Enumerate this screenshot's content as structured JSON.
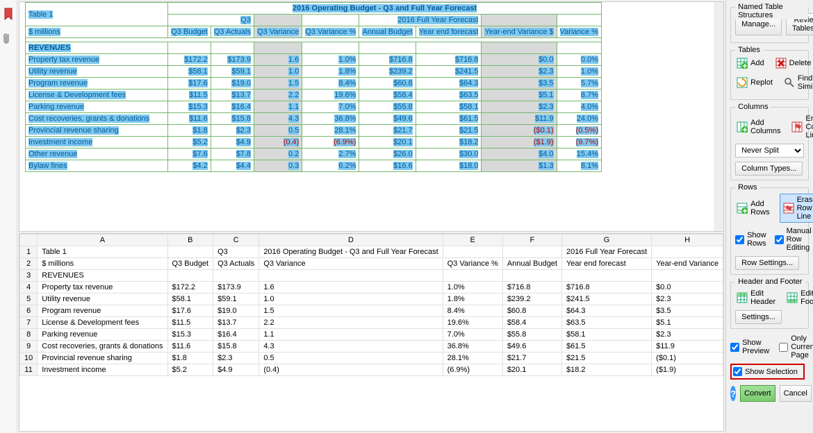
{
  "preview": {
    "title": "2016 Operating Budget - Q3 and Full Year Forecast",
    "table_label": "Table 1",
    "q3_label": "Q3",
    "fy_label": "2016 Full Year Forecast",
    "unit": "$ millions",
    "headers": [
      "Q3 Budget",
      "Q3 Actuals",
      "Q3 Variance",
      "Q3 Variance %",
      "Annual Budget",
      "Year end forecast",
      "Year-end Variance $",
      "Variance %"
    ],
    "section": "REVENUES",
    "rows": [
      {
        "label": "Property tax revenue",
        "v": [
          "$172.2",
          "$173.9",
          "1.6",
          "1.0%",
          "$716.8",
          "$716.8",
          "$0.0",
          "0.0%"
        ]
      },
      {
        "label": "Utility revenue",
        "v": [
          "$58.1",
          "$59.1",
          "1.0",
          "1.8%",
          "$239.2",
          "$241.5",
          "$2.3",
          "1.0%"
        ]
      },
      {
        "label": "Program revenue",
        "v": [
          "$17.6",
          "$19.0",
          "1.5",
          "8.4%",
          "$60.8",
          "$64.3",
          "$3.5",
          "5.7%"
        ]
      },
      {
        "label": "License & Development fees",
        "v": [
          "$11.5",
          "$13.7",
          "2.2",
          "19.6%",
          "$58.4",
          "$63.5",
          "$5.1",
          "8.7%"
        ]
      },
      {
        "label": "Parking revenue",
        "v": [
          "$15.3",
          "$16.4",
          "1.1",
          "7.0%",
          "$55.8",
          "$58.1",
          "$2.3",
          "4.0%"
        ]
      },
      {
        "label": "Cost recoveries, grants & donations",
        "v": [
          "$11.6",
          "$15.8",
          "4.3",
          "36.8%",
          "$49.6",
          "$61.5",
          "$11.9",
          "24.0%"
        ]
      },
      {
        "label": "Provincial revenue sharing",
        "v": [
          "$1.8",
          "$2.3",
          "0.5",
          "28.1%",
          "$21.7",
          "$21.5",
          "($0.1)",
          "(0.5%)"
        ],
        "neg": [
          6,
          7
        ]
      },
      {
        "label": "Investment income",
        "v": [
          "$5.2",
          "$4.9",
          "(0.4)",
          "(6.9%)",
          "$20.1",
          "$18.2",
          "($1.9)",
          "(9.7%)"
        ],
        "neg": [
          2,
          3,
          6,
          7
        ]
      },
      {
        "label": "Other revenue",
        "v": [
          "$7.6",
          "$7.8",
          "0.2",
          "2.7%",
          "$26.0",
          "$30.0",
          "$4.0",
          "15.4%"
        ]
      },
      {
        "label": "Bylaw fines",
        "v": [
          "$4.2",
          "$4.4",
          "0.3",
          "6.2%",
          "$16.6",
          "$18.0",
          "$1.3",
          "8.1%"
        ]
      }
    ]
  },
  "grid": {
    "cols": [
      "A",
      "B",
      "C",
      "D",
      "E",
      "F",
      "G",
      "H"
    ],
    "rows": [
      [
        "Table 1",
        "",
        "Q3",
        "2016 Operating Budget - Q3 and Full Year Forecast",
        "",
        "",
        "2016 Full Year Forecast",
        ""
      ],
      [
        "$ millions",
        "Q3 Budget",
        "Q3 Actuals",
        "Q3\nVariance",
        "Q3\nVariance %",
        "Annual\nBudget",
        "Year end\nforecast",
        "Year-end\nVariance"
      ],
      [
        "REVENUES",
        "",
        "",
        "",
        "",
        "",
        "",
        ""
      ],
      [
        "Property tax revenue",
        "$172.2",
        "$173.9",
        "1.6",
        "1.0%",
        "$716.8",
        "$716.8",
        "$0.0"
      ],
      [
        "Utility revenue",
        "$58.1",
        "$59.1",
        "1.0",
        "1.8%",
        "$239.2",
        "$241.5",
        "$2.3"
      ],
      [
        "Program revenue",
        "$17.6",
        "$19.0",
        "1.5",
        "8.4%",
        "$60.8",
        "$64.3",
        "$3.5"
      ],
      [
        "License & Development fees",
        "$11.5",
        "$13.7",
        "2.2",
        "19.6%",
        "$58.4",
        "$63.5",
        "$5.1"
      ],
      [
        "Parking revenue",
        "$15.3",
        "$16.4",
        "1.1",
        "7.0%",
        "$55.8",
        "$58.1",
        "$2.3"
      ],
      [
        "Cost recoveries, grants & donations",
        "$11.6",
        "$15.8",
        "4.3",
        "36.8%",
        "$49.6",
        "$61.5",
        "$11.9"
      ],
      [
        "Provincial revenue sharing",
        "$1.8",
        "$2.3",
        "0.5",
        "28.1%",
        "$21.7",
        "$21.5",
        "($0.1)"
      ],
      [
        "Investment income",
        "$5.2",
        "$4.9",
        "(0.4)",
        "(6.9%)",
        "$20.1",
        "$18.2",
        "($1.9)"
      ]
    ]
  },
  "sidebar": {
    "named_structures": "Named Table Structures",
    "manage": "Manage...",
    "review": "Review Tables...",
    "tables": "Tables",
    "add": "Add",
    "delete": "Delete",
    "replot": "Replot",
    "find_similar": "Find Similar",
    "columns": "Columns",
    "add_columns": "Add Columns",
    "erase_col": "Erase Column Line",
    "never_split": "Never Split",
    "col_types": "Column Types...",
    "rows": "Rows",
    "add_rows": "Add Rows",
    "erase_row": "Erase Row Line",
    "show_rows": "Show Rows",
    "manual_row": "Manual Row Editing",
    "row_settings": "Row Settings...",
    "header_footer": "Header and Footer",
    "edit_header": "Edit Header",
    "edit_footer": "Edit Footer",
    "settings": "Settings...",
    "show_preview": "Show Preview",
    "only_current": "Only Current Page",
    "show_selection": "Show Selection",
    "convert": "Convert",
    "cancel": "Cancel"
  }
}
